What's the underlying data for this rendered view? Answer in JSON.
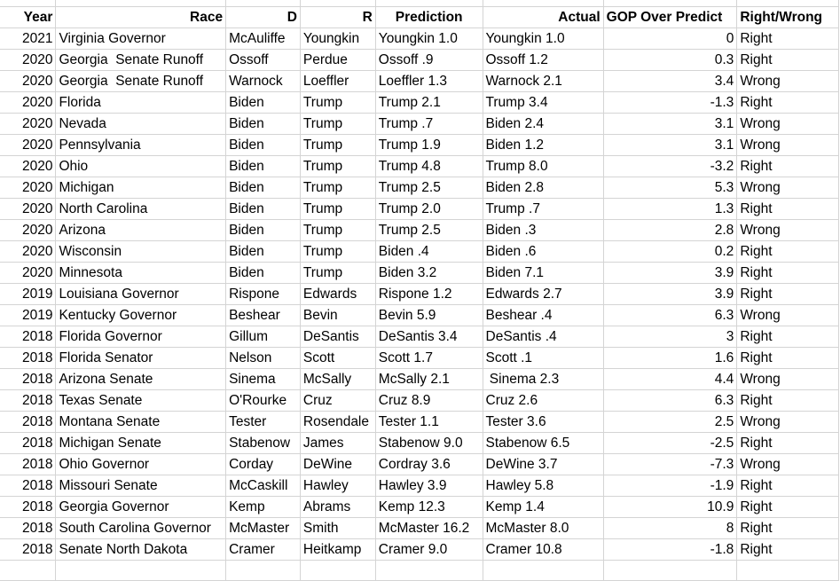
{
  "headers": {
    "year": "Year",
    "race": "Race",
    "d": "D",
    "r": "R",
    "prediction": "Prediction",
    "actual": "Actual",
    "gop_over_predict": "GOP Over Predict",
    "right_wrong": "Right/Wrong"
  },
  "rows": [
    {
      "year": "2021",
      "race": "Virginia Governor",
      "d": "McAuliffe",
      "r": "Youngkin",
      "prediction": "Youngkin 1.0",
      "actual": "Youngkin 1.0",
      "gop": "0",
      "rw": "Right"
    },
    {
      "year": "2020",
      "race": "Georgia  Senate Runoff",
      "d": "Ossoff",
      "r": "Perdue",
      "prediction": "Ossoff .9",
      "actual": "Ossoff 1.2",
      "gop": "0.3",
      "rw": "Right"
    },
    {
      "year": "2020",
      "race": "Georgia  Senate Runoff",
      "d": "Warnock",
      "r": "Loeffler",
      "prediction": "Loeffler 1.3",
      "actual": "Warnock 2.1",
      "gop": "3.4",
      "rw": "Wrong"
    },
    {
      "year": "2020",
      "race": "Florida",
      "d": "Biden",
      "r": "Trump",
      "prediction": "Trump 2.1",
      "actual": "Trump 3.4",
      "gop": "-1.3",
      "rw": "Right"
    },
    {
      "year": "2020",
      "race": "Nevada",
      "d": "Biden",
      "r": "Trump",
      "prediction": "Trump .7",
      "actual": "Biden 2.4",
      "gop": "3.1",
      "rw": "Wrong"
    },
    {
      "year": "2020",
      "race": "Pennsylvania",
      "d": "Biden",
      "r": "Trump",
      "prediction": "Trump 1.9",
      "actual": "Biden 1.2",
      "gop": "3.1",
      "rw": "Wrong"
    },
    {
      "year": "2020",
      "race": "Ohio",
      "d": "Biden",
      "r": "Trump",
      "prediction": "Trump 4.8",
      "actual": "Trump 8.0",
      "gop": "-3.2",
      "rw": "Right"
    },
    {
      "year": "2020",
      "race": "Michigan",
      "d": "Biden",
      "r": "Trump",
      "prediction": "Trump 2.5",
      "actual": "Biden 2.8",
      "gop": "5.3",
      "rw": "Wrong"
    },
    {
      "year": "2020",
      "race": "North Carolina",
      "d": "Biden",
      "r": "Trump",
      "prediction": "Trump 2.0",
      "actual": "Trump .7",
      "gop": "1.3",
      "rw": "Right"
    },
    {
      "year": "2020",
      "race": "Arizona",
      "d": "Biden",
      "r": "Trump",
      "prediction": "Trump 2.5",
      "actual": "Biden .3",
      "gop": "2.8",
      "rw": "Wrong"
    },
    {
      "year": "2020",
      "race": "Wisconsin",
      "d": "Biden",
      "r": "Trump",
      "prediction": "Biden .4",
      "actual": "Biden .6",
      "gop": "0.2",
      "rw": "Right"
    },
    {
      "year": "2020",
      "race": "Minnesota",
      "d": "Biden",
      "r": "Trump",
      "prediction": "Biden 3.2",
      "actual": "Biden 7.1",
      "gop": "3.9",
      "rw": "Right"
    },
    {
      "year": "2019",
      "race": "Louisiana Governor",
      "d": "Rispone",
      "r": "Edwards",
      "prediction": "Rispone 1.2",
      "actual": "Edwards 2.7",
      "gop": "3.9",
      "rw": "Right"
    },
    {
      "year": "2019",
      "race": "Kentucky Governor",
      "d": "Beshear",
      "r": "Bevin",
      "prediction": "Bevin 5.9",
      "actual": "Beshear .4",
      "gop": "6.3",
      "rw": "Wrong"
    },
    {
      "year": "2018",
      "race": "Florida Governor",
      "d": "Gillum",
      "r": "DeSantis",
      "prediction": "DeSantis 3.4",
      "actual": "DeSantis .4",
      "gop": "3",
      "rw": "Right"
    },
    {
      "year": "2018",
      "race": "Florida Senator",
      "d": "Nelson",
      "r": "Scott",
      "prediction": "Scott 1.7",
      "actual": "Scott .1",
      "gop": "1.6",
      "rw": "Right"
    },
    {
      "year": "2018",
      "race": "Arizona Senate",
      "d": "Sinema",
      "r": "McSally",
      "prediction": "McSally 2.1",
      "actual": " Sinema 2.3",
      "gop": "4.4",
      "rw": "Wrong"
    },
    {
      "year": "2018",
      "race": "Texas Senate",
      "d": "O'Rourke",
      "r": "Cruz",
      "prediction": "Cruz 8.9",
      "actual": "Cruz 2.6",
      "gop": "6.3",
      "rw": "Right"
    },
    {
      "year": "2018",
      "race": "Montana Senate",
      "d": "Tester",
      "r": "Rosendale",
      "prediction": "Tester 1.1",
      "actual": "Tester 3.6",
      "gop": "2.5",
      "rw": "Wrong"
    },
    {
      "year": "2018",
      "race": "Michigan Senate",
      "d": "Stabenow",
      "r": "James",
      "prediction": "Stabenow 9.0",
      "actual": "Stabenow 6.5",
      "gop": "-2.5",
      "rw": "Right"
    },
    {
      "year": "2018",
      "race": "Ohio Governor",
      "d": "Corday",
      "r": "DeWine",
      "prediction": "Cordray 3.6",
      "actual": "DeWine 3.7",
      "gop": "-7.3",
      "rw": "Wrong"
    },
    {
      "year": "2018",
      "race": "Missouri Senate",
      "d": "McCaskill",
      "r": "Hawley",
      "prediction": "Hawley 3.9",
      "actual": "Hawley 5.8",
      "gop": "-1.9",
      "rw": "Right"
    },
    {
      "year": "2018",
      "race": "Georgia Governor",
      "d": "Kemp",
      "r": "Abrams",
      "prediction": "Kemp 12.3",
      "actual": "Kemp 1.4",
      "gop": "10.9",
      "rw": "Right"
    },
    {
      "year": "2018",
      "race": "South Carolina Governor",
      "d": "McMaster",
      "r": "Smith",
      "prediction": "McMaster 16.2",
      "actual": "McMaster 8.0",
      "gop": "8",
      "rw": "Right"
    },
    {
      "year": "2018",
      "race": "Senate North Dakota",
      "d": "Cramer",
      "r": "Heitkamp",
      "prediction": "Cramer 9.0",
      "actual": "Cramer 10.8",
      "gop": "-1.8",
      "rw": "Right"
    }
  ]
}
